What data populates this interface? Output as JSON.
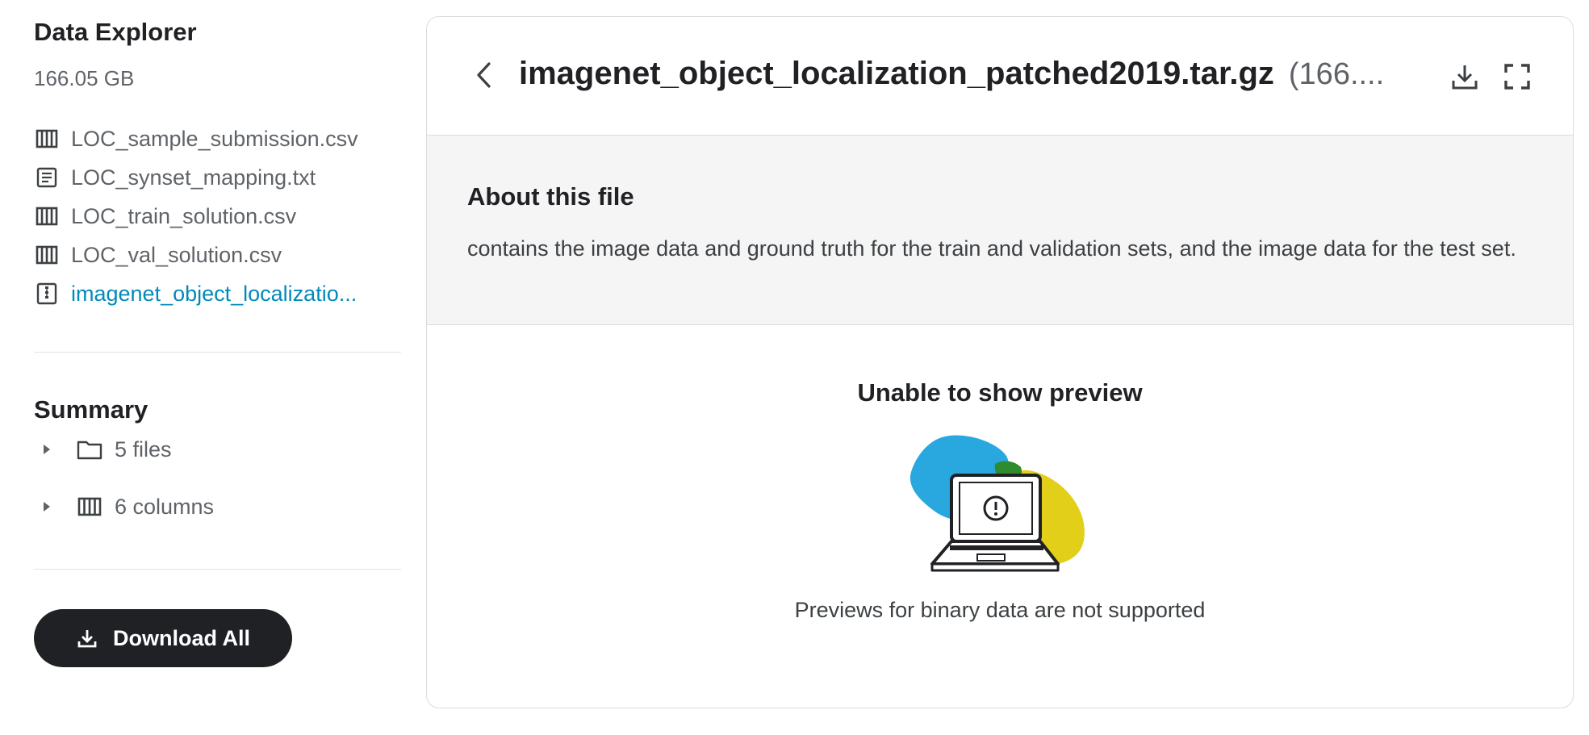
{
  "sidebar": {
    "title": "Data Explorer",
    "size": "166.05 GB",
    "files": [
      {
        "label": "LOC_sample_submission.csv",
        "icon": "table-icon"
      },
      {
        "label": "LOC_synset_mapping.txt",
        "icon": "text-file-icon"
      },
      {
        "label": "LOC_train_solution.csv",
        "icon": "table-icon"
      },
      {
        "label": "LOC_val_solution.csv",
        "icon": "table-icon"
      },
      {
        "label": "imagenet_object_localizatio...",
        "icon": "archive-icon",
        "active": true
      }
    ],
    "summary": {
      "title": "Summary",
      "files_label": "5 files",
      "columns_label": "6 columns"
    },
    "download_all_label": "Download All"
  },
  "panel": {
    "file_name": "imagenet_object_localization_patched2019.tar.gz",
    "file_size": "(166....",
    "about_title": "About this file",
    "about_text": "contains the image data and ground truth for the train and validation sets, and the image data for the test set.",
    "preview_title": "Unable to show preview",
    "preview_text": "Previews for binary data are not supported"
  },
  "colors": {
    "accent_link": "#008aba",
    "button_dark": "#202124",
    "illustration_blue": "#29a8e0",
    "illustration_yellow": "#e2cf19",
    "illustration_green": "#2e8b2e"
  }
}
